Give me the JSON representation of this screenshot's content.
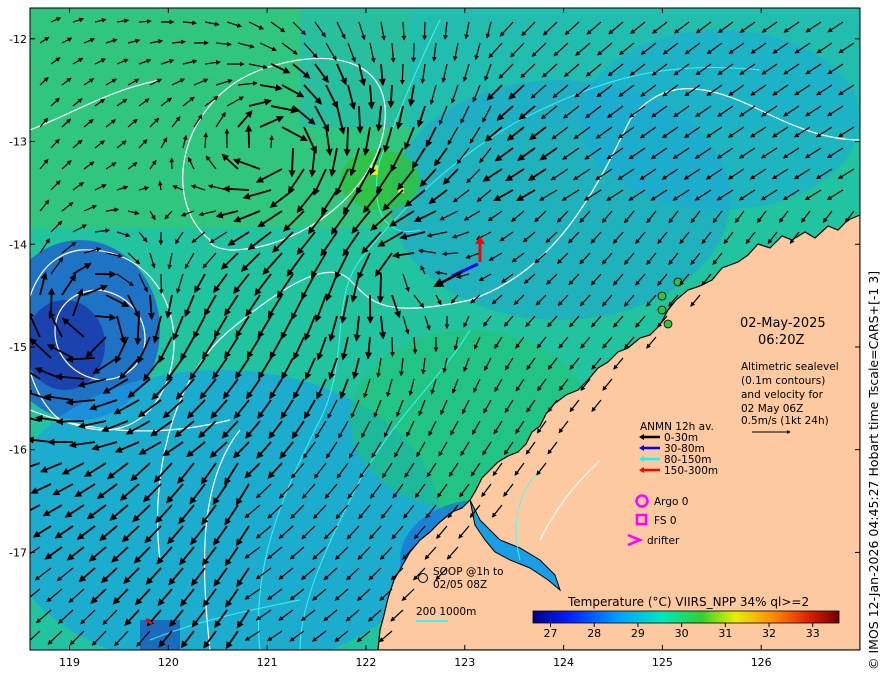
{
  "map": {
    "lon_ticks": [
      119,
      120,
      121,
      122,
      123,
      124,
      125,
      126
    ],
    "lat_ticks": [
      -12,
      -13,
      -14,
      -15,
      -16,
      -17
    ],
    "lon_range": [
      118.6,
      127.0
    ],
    "lat_range": [
      -17.95,
      -11.7
    ]
  },
  "date_label": "02-May-2025",
  "time_label": "06:20Z",
  "altimetry_note": {
    "lines": [
      "Altimetric sealevel",
      "(0.1m contours)",
      "and velocity for",
      "02 May 06Z",
      "0.5m/s (1kt 24h)"
    ]
  },
  "anmn": {
    "title": "ANMN 12h av.",
    "items": [
      {
        "label": "0-30m",
        "color": "#000000"
      },
      {
        "label": "30-80m",
        "color": "#0000ff"
      },
      {
        "label": "80-150m",
        "color": "#00ffff"
      },
      {
        "label": "150-300m",
        "color": "#ff0000"
      }
    ]
  },
  "markers": {
    "argo": "Argo 0",
    "fs": "FS 0",
    "drifter": "drifter",
    "marker_color": "#ff00ff"
  },
  "soop": {
    "lines": [
      "SOOP @1h to",
      "02/05 08Z"
    ]
  },
  "isobath": {
    "label": "200  1000m",
    "color": "#00ffff"
  },
  "colorbar": {
    "title": "Temperature (°C) VIIRS_NPP 34% ql>=2",
    "ticks": [
      27,
      28,
      29,
      30,
      31,
      32,
      33
    ],
    "range": [
      26.6,
      33.6
    ]
  },
  "credit": "© IMOS 12-Jan-2026 04:45:27 Hobart time Tscale=CARS+[-1 3]",
  "colors": {
    "land": "#fcc9a0",
    "sea_warm": "#22c55a",
    "sea_cool": "#1e9be6"
  }
}
